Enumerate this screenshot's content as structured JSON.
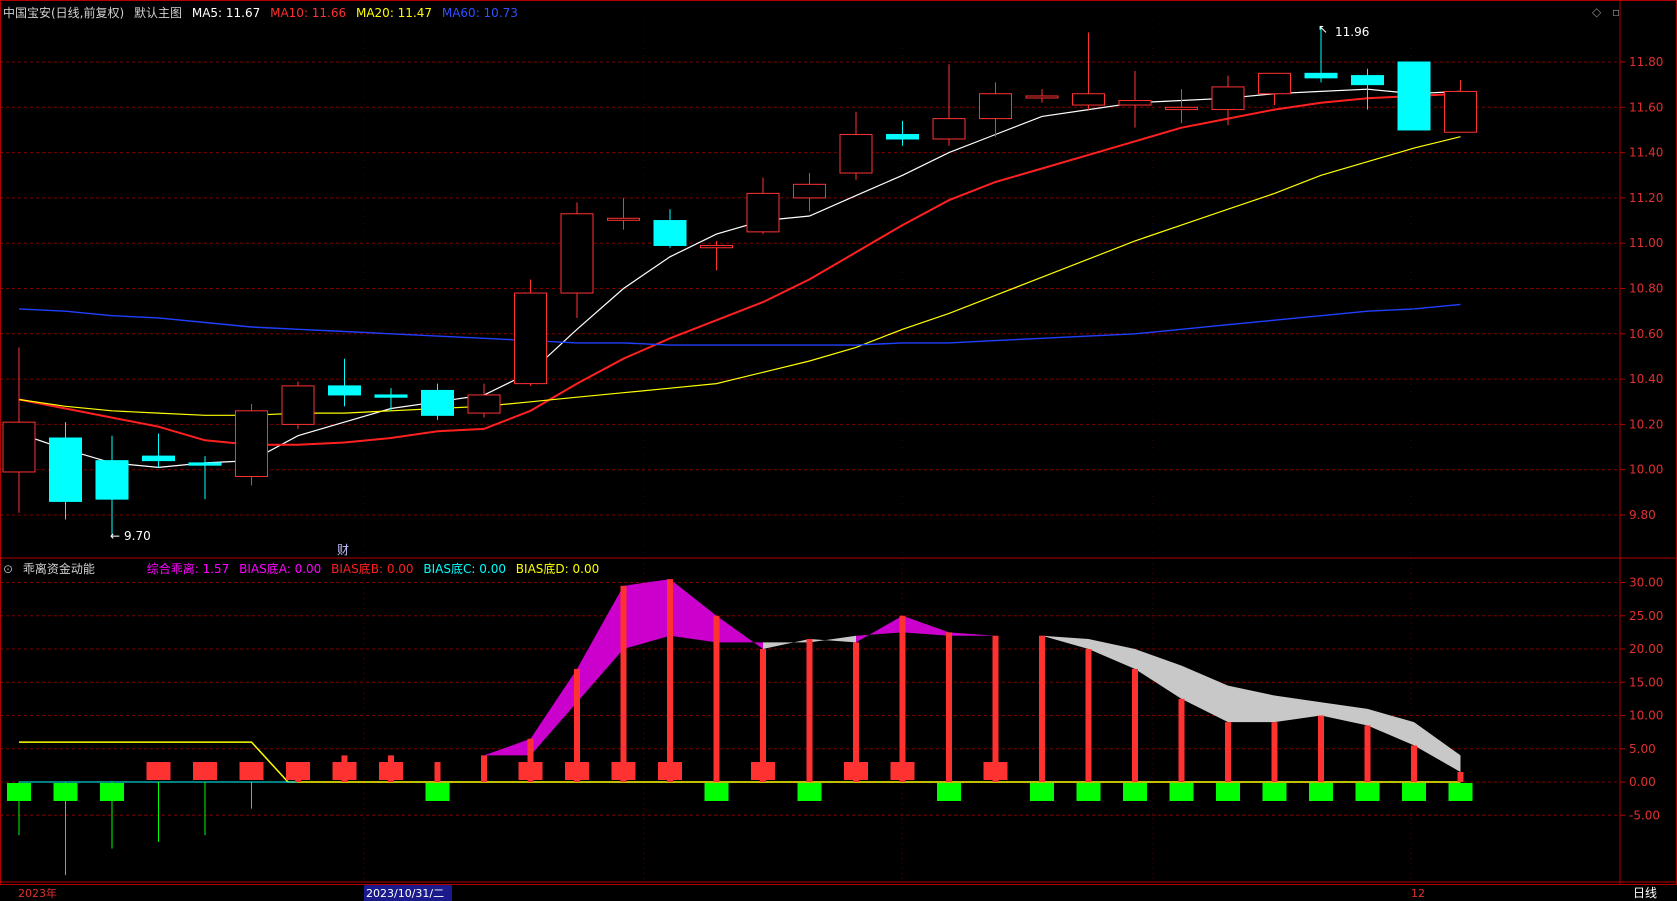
{
  "header": {
    "stock": "中国宝安(日线,前复权)",
    "chart_name": "默认主图",
    "ma5": "MA5: 11.67",
    "ma10": "MA10: 11.66",
    "ma20": "MA20: 11.47",
    "ma60": "MA60: 10.73"
  },
  "sub_header": {
    "indicator": "乖离资金动能",
    "zonghe": "综合乖离: 1.57",
    "biasA": "BIAS底A: 0.00",
    "biasB": "BIAS底B: 0.00",
    "biasC": "BIAS底C: 0.00",
    "biasD": "BIAS底D: 0.00"
  },
  "annotations": {
    "high_label": "11.96",
    "low_label": "9.70",
    "fin_marker": "财"
  },
  "x_axis": {
    "year_label": "2023年",
    "selected_date": "2023/10/31/二",
    "month_label": "12",
    "period": "日线"
  },
  "colors": {
    "up": "#ff3232",
    "down": "#00ffff",
    "ma5": "#ffffff",
    "ma10": "#ff2020",
    "ma20": "#ffff00",
    "ma60": "#2040ff",
    "magenta": "#cc00cc",
    "gray": "#c8c8c8",
    "green": "#00ff00",
    "grid": "#7a0000"
  },
  "chart_data": [
    {
      "type": "candlestick",
      "title": "中国宝安(日线,前复权)",
      "ylim": [
        9.6,
        12.05
      ],
      "yticks": [
        "11.80",
        "11.60",
        "11.40",
        "11.20",
        "11.00",
        "10.80",
        "10.60",
        "10.40",
        "10.20",
        "10.00",
        "9.80"
      ],
      "candles": [
        {
          "o": 9.99,
          "h": 10.54,
          "l": 9.81,
          "c": 10.21
        },
        {
          "o": 10.14,
          "h": 10.21,
          "l": 9.78,
          "c": 9.86
        },
        {
          "o": 10.04,
          "h": 10.15,
          "l": 9.7,
          "c": 9.87
        },
        {
          "o": 10.06,
          "h": 10.16,
          "l": 10.01,
          "c": 10.04
        },
        {
          "o": 10.03,
          "h": 10.06,
          "l": 9.87,
          "c": 10.02
        },
        {
          "o": 9.97,
          "h": 10.29,
          "l": 9.93,
          "c": 10.26
        },
        {
          "o": 10.2,
          "h": 10.39,
          "l": 10.18,
          "c": 10.37
        },
        {
          "o": 10.37,
          "h": 10.49,
          "l": 10.28,
          "c": 10.33
        },
        {
          "o": 10.33,
          "h": 10.36,
          "l": 10.26,
          "c": 10.32
        },
        {
          "o": 10.35,
          "h": 10.38,
          "l": 10.22,
          "c": 10.24
        },
        {
          "o": 10.25,
          "h": 10.38,
          "l": 10.23,
          "c": 10.33
        },
        {
          "o": 10.38,
          "h": 10.84,
          "l": 10.37,
          "c": 10.78
        },
        {
          "o": 10.78,
          "h": 11.18,
          "l": 10.67,
          "c": 11.13
        },
        {
          "o": 11.11,
          "h": 11.2,
          "l": 11.06,
          "c": 11.11
        },
        {
          "o": 11.1,
          "h": 11.15,
          "l": 10.98,
          "c": 10.99
        },
        {
          "o": 10.98,
          "h": 11.01,
          "l": 10.88,
          "c": 10.99
        },
        {
          "o": 11.05,
          "h": 11.29,
          "l": 11.04,
          "c": 11.22
        },
        {
          "o": 11.2,
          "h": 11.31,
          "l": 11.14,
          "c": 11.26
        },
        {
          "o": 11.31,
          "h": 11.58,
          "l": 11.28,
          "c": 11.48
        },
        {
          "o": 11.48,
          "h": 11.54,
          "l": 11.43,
          "c": 11.46
        },
        {
          "o": 11.46,
          "h": 11.79,
          "l": 11.43,
          "c": 11.55
        },
        {
          "o": 11.55,
          "h": 11.71,
          "l": 11.47,
          "c": 11.66
        },
        {
          "o": 11.65,
          "h": 11.68,
          "l": 11.62,
          "c": 11.65
        },
        {
          "o": 11.61,
          "h": 11.93,
          "l": 11.59,
          "c": 11.66
        },
        {
          "o": 11.61,
          "h": 11.76,
          "l": 11.51,
          "c": 11.63
        },
        {
          "o": 11.59,
          "h": 11.68,
          "l": 11.53,
          "c": 11.6
        },
        {
          "o": 11.59,
          "h": 11.74,
          "l": 11.52,
          "c": 11.69
        },
        {
          "o": 11.66,
          "h": 11.75,
          "l": 11.61,
          "c": 11.75
        },
        {
          "o": 11.75,
          "h": 11.96,
          "l": 11.71,
          "c": 11.73
        },
        {
          "o": 11.74,
          "h": 11.77,
          "l": 11.59,
          "c": 11.7
        },
        {
          "o": 11.8,
          "h": 11.8,
          "l": 11.5,
          "c": 11.5
        },
        {
          "o": 11.49,
          "h": 11.72,
          "l": 11.49,
          "c": 11.67
        }
      ],
      "series": [
        {
          "name": "MA5",
          "values": [
            10.16,
            10.09,
            10.03,
            10.01,
            10.03,
            10.04,
            10.15,
            10.21,
            10.27,
            10.3,
            10.33,
            10.43,
            10.62,
            10.8,
            10.94,
            11.04,
            11.1,
            11.12,
            11.21,
            11.3,
            11.4,
            11.48,
            11.56,
            11.59,
            11.62,
            11.63,
            11.64,
            11.66,
            11.67,
            11.68,
            11.66,
            11.67
          ]
        },
        {
          "name": "MA10",
          "values": [
            10.31,
            10.27,
            10.23,
            10.19,
            10.13,
            10.11,
            10.11,
            10.12,
            10.14,
            10.17,
            10.18,
            10.26,
            10.38,
            10.49,
            10.58,
            10.66,
            10.74,
            10.84,
            10.96,
            11.08,
            11.19,
            11.27,
            11.33,
            11.39,
            11.45,
            11.51,
            11.55,
            11.59,
            11.62,
            11.64,
            11.65,
            11.66
          ]
        },
        {
          "name": "MA20",
          "values": [
            10.31,
            10.28,
            10.26,
            10.25,
            10.24,
            10.24,
            10.25,
            10.25,
            10.26,
            10.27,
            10.28,
            10.3,
            10.32,
            10.34,
            10.36,
            10.38,
            10.43,
            10.48,
            10.54,
            10.62,
            10.69,
            10.77,
            10.85,
            10.93,
            11.01,
            11.08,
            11.15,
            11.22,
            11.3,
            11.36,
            11.42,
            11.47
          ]
        },
        {
          "name": "MA60",
          "values": [
            10.71,
            10.7,
            10.68,
            10.67,
            10.65,
            10.63,
            10.62,
            10.61,
            10.6,
            10.59,
            10.58,
            10.57,
            10.56,
            10.56,
            10.55,
            10.55,
            10.55,
            10.55,
            10.55,
            10.56,
            10.56,
            10.57,
            10.58,
            10.59,
            10.6,
            10.62,
            10.64,
            10.66,
            10.68,
            10.7,
            10.71,
            10.73
          ]
        }
      ]
    },
    {
      "type": "bar",
      "title": "乖离资金动能",
      "ylim": [
        -10,
        33
      ],
      "yticks": [
        "30.00",
        "25.00",
        "20.00",
        "15.00",
        "10.00",
        "5.00",
        "0.00",
        "-5.00"
      ],
      "series": [
        {
          "name": "综合乖离",
          "values": [
            -8,
            -14,
            -10,
            -9,
            -8,
            -4,
            1,
            4,
            4,
            3,
            4,
            4,
            12,
            20,
            22,
            21,
            21,
            21,
            22,
            22.5,
            22,
            22,
            22,
            21.5,
            20,
            17.5,
            14.5,
            13,
            12,
            11,
            9,
            4
          ]
        },
        {
          "name": "signal_line",
          "values": [
            -8,
            -14,
            -10,
            -9,
            -8,
            -4,
            1,
            4,
            4,
            3,
            4,
            6.5,
            17,
            29.5,
            30.5,
            25,
            20,
            21.5,
            21,
            25,
            22.5,
            22,
            22,
            20,
            17,
            12.5,
            9,
            9,
            10,
            8.5,
            5.5,
            1.5
          ]
        },
        {
          "name": "level_line",
          "values": [
            6,
            6,
            6,
            6,
            6,
            6,
            0,
            0,
            0,
            0,
            0,
            0,
            0,
            0,
            0,
            0,
            0,
            0,
            0,
            0,
            0,
            0,
            0,
            0,
            0,
            0,
            0,
            0,
            0,
            0,
            0,
            0
          ]
        },
        {
          "name": "red_markers",
          "values": [
            0,
            0,
            0,
            1,
            1,
            1,
            1,
            1,
            1,
            0,
            0,
            1,
            1,
            1,
            1,
            0,
            1,
            0,
            1,
            1,
            0,
            1,
            0,
            0,
            0,
            0,
            0,
            0,
            0,
            0,
            0,
            0
          ]
        },
        {
          "name": "green_markers",
          "values": [
            1,
            1,
            1,
            0,
            0,
            0,
            0,
            0,
            0,
            1,
            0,
            0,
            0,
            0,
            0,
            1,
            0,
            1,
            0,
            0,
            1,
            0,
            1,
            1,
            1,
            1,
            1,
            1,
            1,
            1,
            1,
            1
          ]
        }
      ]
    }
  ]
}
